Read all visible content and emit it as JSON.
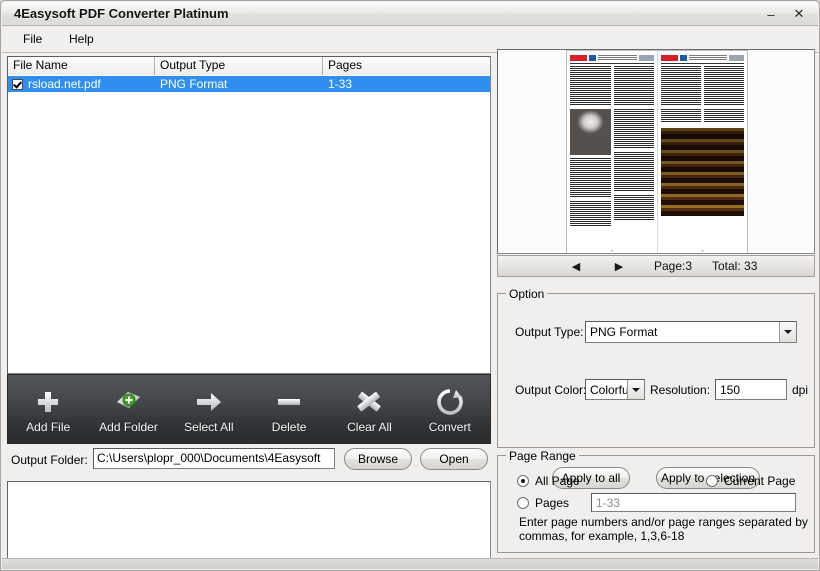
{
  "window": {
    "title": "4Easysoft PDF Converter Platinum",
    "minimize_label": "–",
    "close_label": "✕"
  },
  "menu": {
    "file": "File",
    "help": "Help"
  },
  "file_list": {
    "columns": [
      "File Name",
      "Output Type",
      "Pages"
    ],
    "rows": [
      {
        "checked": true,
        "name": "rsload.net.pdf",
        "output_type": "PNG Format",
        "pages": "1-33"
      }
    ],
    "selection_color": "#2f8ff0"
  },
  "toolbar": {
    "items": [
      {
        "icon": "plus-icon",
        "label": "Add File"
      },
      {
        "icon": "folder-add-icon",
        "label": "Add Folder"
      },
      {
        "icon": "arrow-right-icon",
        "label": "Select All"
      },
      {
        "icon": "minus-icon",
        "label": "Delete"
      },
      {
        "icon": "cross-icon",
        "label": "Clear All"
      },
      {
        "icon": "refresh-icon",
        "label": "Convert"
      }
    ]
  },
  "output_folder": {
    "label": "Output Folder:",
    "path": "C:\\Users\\plopr_000\\Documents\\4Easysoft",
    "browse_label": "Browse",
    "open_label": "Open"
  },
  "preview": {
    "prev_icon": "triangle-left-icon",
    "next_icon": "triangle-right-icon",
    "page_label": "Page:3",
    "total_label": "Total: 33",
    "left_page_number": "4",
    "right_page_number": "5"
  },
  "option": {
    "title": "Option",
    "output_type_label": "Output Type:",
    "output_type_value": "PNG Format",
    "output_color_label": "Output Color:",
    "output_color_value": "Colorful",
    "resolution_label": "Resolution:",
    "resolution_value": "150",
    "dpi_label": "dpi",
    "apply_all_label": "Apply to all",
    "apply_selection_label": "Apply to selection"
  },
  "page_range": {
    "title": "Page Range",
    "all_page_label": "All Page",
    "current_page_label": "Current Page",
    "pages_label": "Pages",
    "pages_placeholder": "1-33",
    "selected": "all_page",
    "hint": "Enter page numbers and/or page ranges separated by commas, for example, 1,3,6-18"
  }
}
